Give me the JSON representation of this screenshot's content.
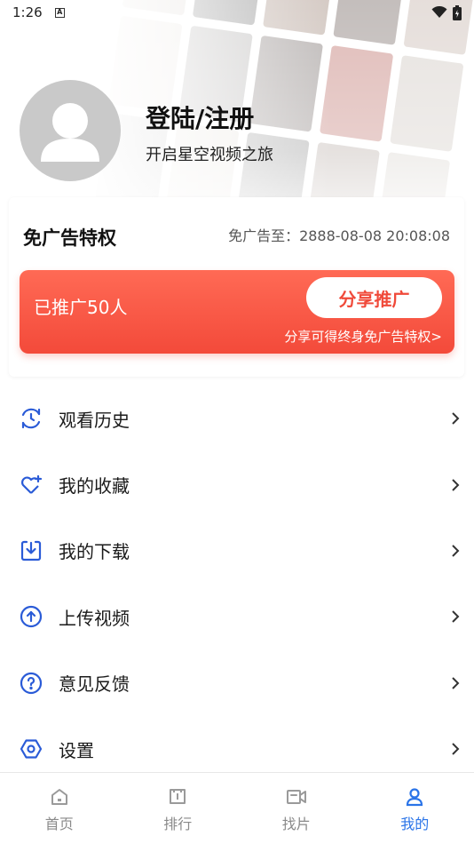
{
  "status_bar": {
    "time": "1:26",
    "notification_icon": "A"
  },
  "profile": {
    "title": "登陆/注册",
    "subtitle": "开启星空视频之旅"
  },
  "ad_free": {
    "title": "免广告特权",
    "expire_text": "免广告至：2888-08-08 20:08:08",
    "promoted_text": "已推广50人",
    "share_button": "分享推广",
    "share_hint": "分享可得终身免广告特权>"
  },
  "menu": [
    {
      "label": "观看历史",
      "icon": "history-icon"
    },
    {
      "label": "我的收藏",
      "icon": "favorite-heart-icon"
    },
    {
      "label": "我的下载",
      "icon": "download-icon"
    },
    {
      "label": "上传视频",
      "icon": "upload-icon"
    },
    {
      "label": "意见反馈",
      "icon": "feedback-question-icon"
    },
    {
      "label": "设置",
      "icon": "settings-icon"
    }
  ],
  "tabs": [
    {
      "label": "首页",
      "icon": "home-icon"
    },
    {
      "label": "排行",
      "icon": "ranking-icon"
    },
    {
      "label": "找片",
      "icon": "video-camera-icon"
    },
    {
      "label": "我的",
      "icon": "user-icon",
      "active": true
    }
  ],
  "colors": {
    "accent": "#2a74e8",
    "promo": "#f34a3a",
    "icon_blue": "#2a5bd7"
  }
}
